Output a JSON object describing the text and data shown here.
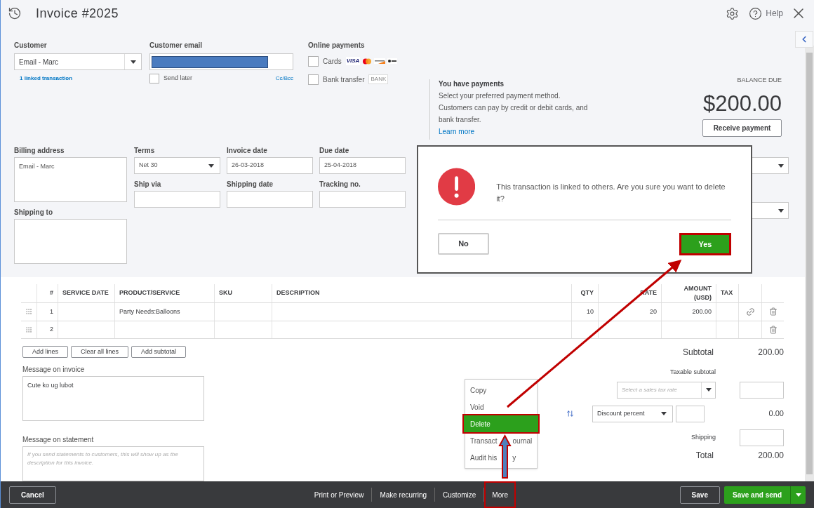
{
  "header": {
    "title": "Invoice #2025",
    "help": "Help"
  },
  "customer": {
    "label": "Customer",
    "value": "Email - Marc",
    "link": "1 linked transaction"
  },
  "email": {
    "label": "Customer email",
    "send_later": {
      "label": "Send later",
      "checked": false
    },
    "cc_bcc": "Cc/Bcc"
  },
  "online_payments": {
    "label": "Online payments",
    "options": [
      {
        "kind": "cards",
        "label": "Cards",
        "checked": false,
        "badge": "VISA"
      },
      {
        "kind": "bank",
        "label": "Bank transfer",
        "checked": false,
        "badge": "BANK"
      }
    ]
  },
  "payments_info": {
    "title": "You have payments",
    "body": "Select your preferred payment method. Customers can pay by credit or debit cards, and bank transfer.",
    "link": "Learn more"
  },
  "balance": {
    "label": "BALANCE DUE",
    "amount": "$200.00",
    "button": "Receive payment"
  },
  "billing": {
    "label": "Billing address",
    "value": "Email - Marc",
    "shipping_label": "Shipping to"
  },
  "fields": [
    {
      "kind": "select",
      "label": "Terms",
      "value": "Net 30"
    },
    {
      "kind": "input",
      "label": "Invoice date",
      "value": "26-03-2018"
    },
    {
      "kind": "input",
      "label": "Due date",
      "value": "25-04-2018"
    },
    {
      "kind": "input",
      "label": "Ship via"
    },
    {
      "kind": "input",
      "label": "Shipping date"
    },
    {
      "kind": "input",
      "label": "Tracking no."
    }
  ],
  "table": {
    "columns": [
      "#",
      "SERVICE DATE",
      "PRODUCT/SERVICE",
      "SKU",
      "DESCRIPTION",
      "QTY",
      "RATE",
      "AMOUNT (USD)",
      "TAX"
    ],
    "rows": [
      {
        "num": "1",
        "product": "Party Needs:Balloons",
        "qty": "10",
        "rate": "20",
        "amount": "200.00",
        "linked": true
      },
      {
        "num": "2",
        "linked": false
      }
    ]
  },
  "table_buttons": [
    "Add lines",
    "Clear all lines",
    "Add subtotal"
  ],
  "subtotal": {
    "label": "Subtotal",
    "value": "200.00"
  },
  "message_invoice": {
    "label": "Message on invoice",
    "value": "Cute ko ug lubot"
  },
  "message_statement": {
    "label": "Message on statement",
    "placeholder": "If you send statements to customers, this will show up as the description for this invoice."
  },
  "tax": {
    "label": "Taxable subtotal",
    "placeholder": "Select a sales tax rate"
  },
  "discount": {
    "value": "Discount percent",
    "amount": "0.00"
  },
  "shipping": {
    "label": "Shipping"
  },
  "total": {
    "label": "Total",
    "value": "200.00"
  },
  "footer": {
    "cancel": "Cancel",
    "actions": [
      {
        "label": "Print or Preview",
        "highlighted": false
      },
      {
        "label": "Make recurring",
        "highlighted": false
      },
      {
        "label": "Customize",
        "highlighted": false
      },
      {
        "label": "More",
        "highlighted": true
      }
    ],
    "save": "Save",
    "save_send": "Save and send"
  },
  "menu": {
    "items": [
      {
        "label": "Copy",
        "selected": false
      },
      {
        "label": "Void",
        "selected": false
      },
      {
        "label": "Delete",
        "selected": true
      },
      {
        "label": "Transact",
        "after_gap": "ournal",
        "selected": false
      },
      {
        "label": "Audit his",
        "after_gap": "y",
        "selected": false
      }
    ]
  },
  "dialog": {
    "message": "This transaction is linked to others. Are you sure you want to delete it?",
    "no": "No",
    "yes": "Yes",
    "yes_highlighted": true
  }
}
